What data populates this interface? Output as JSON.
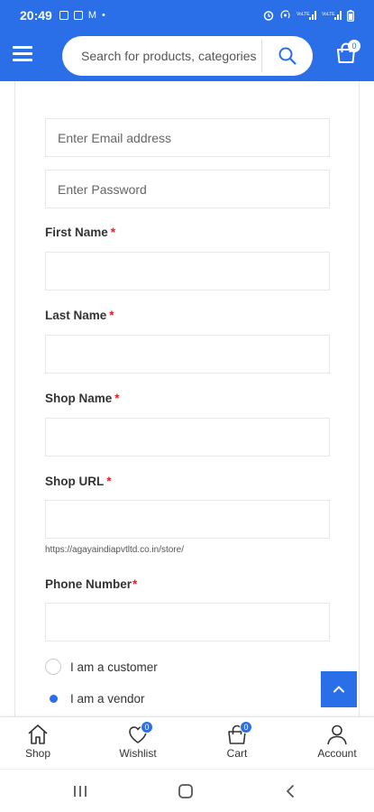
{
  "status": {
    "time": "20:49",
    "indicators": [
      "M",
      "•"
    ],
    "right": [
      "VoLTE LTE1",
      "VoLTE LTE2",
      "battery"
    ]
  },
  "header": {
    "search_placeholder": "Search for products, categories",
    "cart_count": "0"
  },
  "form": {
    "email_placeholder": "Enter Email address",
    "password_placeholder": "Enter Password",
    "first_name_label": "First Name",
    "last_name_label": "Last Name",
    "shop_name_label": "Shop Name",
    "shop_url_label": "Shop URL",
    "shop_url_hint": "https://agayaindiapvtltd.co.in/store/",
    "phone_label": "Phone Number",
    "required_mark": "*",
    "role_options": [
      {
        "label": "I am a customer",
        "selected": false
      },
      {
        "label": "I am a vendor",
        "selected": true
      }
    ]
  },
  "bottom_nav": {
    "shop": "Shop",
    "wishlist": "Wishlist",
    "wishlist_count": "0",
    "cart": "Cart",
    "cart_count": "0",
    "account": "Account"
  },
  "colors": {
    "primary": "#2a6fe8",
    "required": "#e0202c"
  }
}
